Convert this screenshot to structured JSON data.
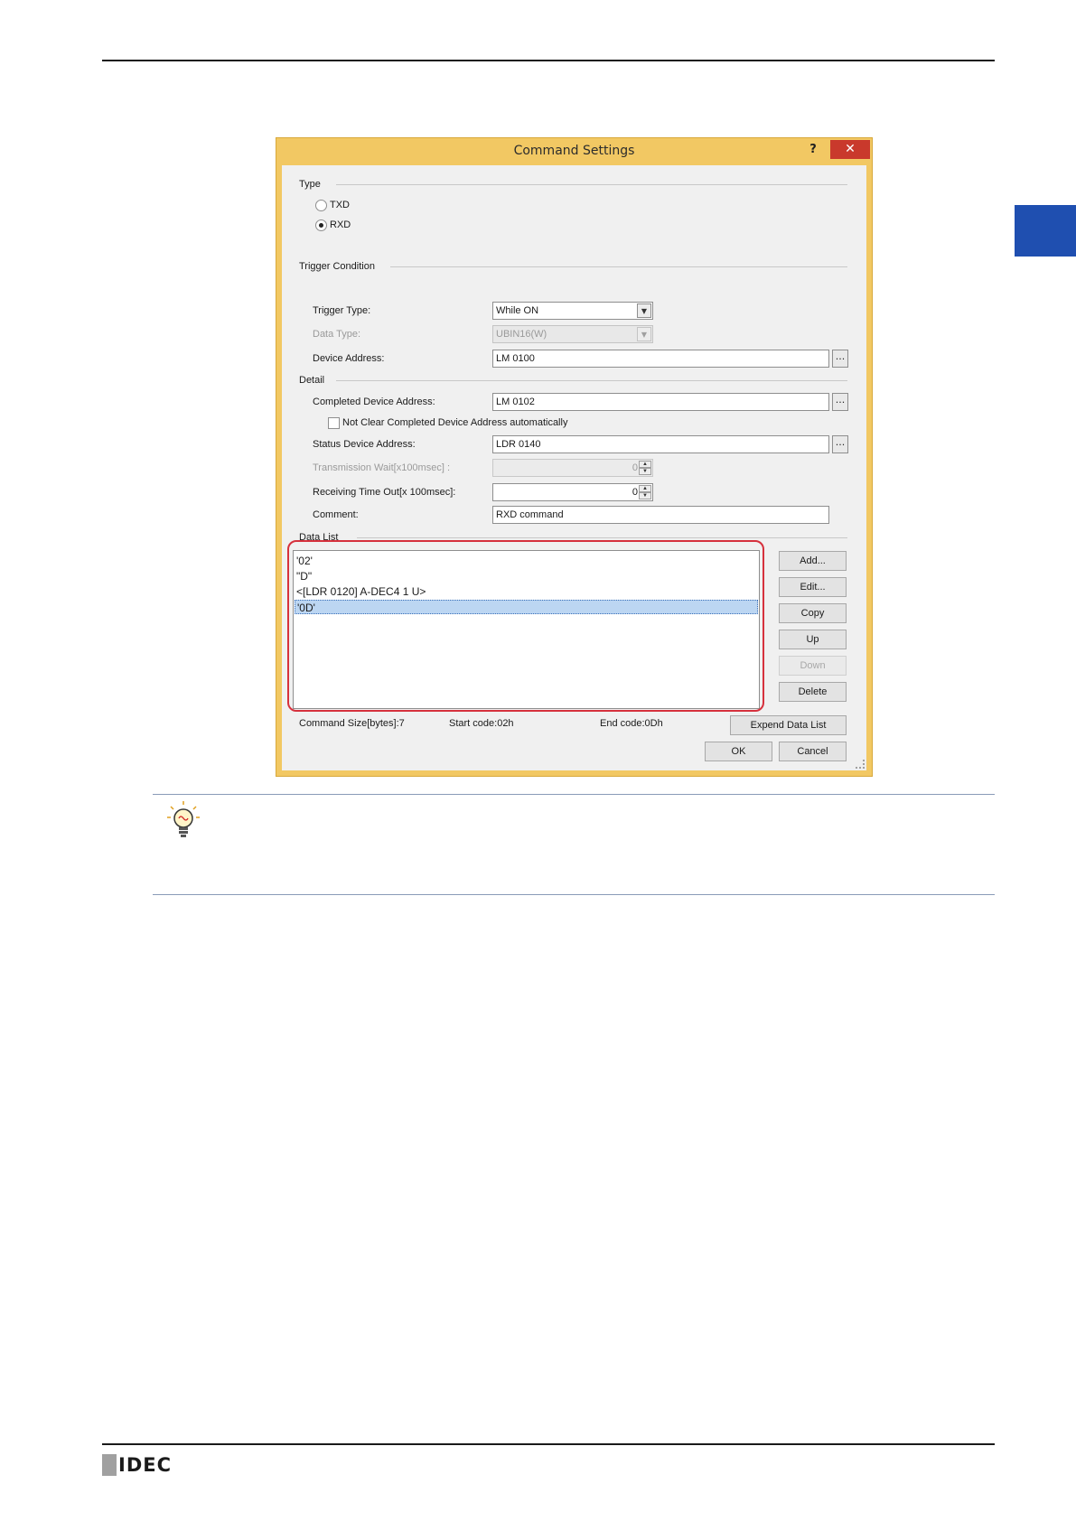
{
  "dialog": {
    "title": "Command Settings",
    "help": "?",
    "close": "✕",
    "type": {
      "label": "Type",
      "options": [
        "TXD",
        "RXD"
      ],
      "selected": "RXD"
    },
    "trigger": {
      "group_label": "Trigger Condition",
      "trigger_type_label": "Trigger Type:",
      "trigger_type_value": "While ON",
      "data_type_label": "Data Type:",
      "data_type_value": "UBIN16(W)",
      "device_address_label": "Device Address:",
      "device_address_value": "LM 0100"
    },
    "detail": {
      "group_label": "Detail",
      "completed_label": "Completed Device Address:",
      "completed_value": "LM 0102",
      "not_clear_label": "Not Clear Completed Device Address automatically",
      "status_label": "Status Device Address:",
      "status_value": "LDR 0140",
      "wait_label": "Transmission Wait[x100msec] :",
      "wait_value": "0",
      "timeout_label": "Receiving Time Out[x 100msec]:",
      "timeout_value": "0",
      "comment_label": "Comment:",
      "comment_value": "RXD command"
    },
    "data_list": {
      "label": "Data List",
      "items": [
        "'02'",
        "\"D\"",
        "<[LDR 0120] A-DEC4 1 U>",
        "'0D'"
      ],
      "selected_index": 3,
      "buttons": {
        "add": "Add...",
        "edit": "Edit...",
        "copy": "Copy",
        "up": "Up",
        "down": "Down",
        "delete": "Delete"
      }
    },
    "footer": {
      "command_size": "Command Size[bytes]:7",
      "start_code": "Start code:02h",
      "end_code": "End code:0Dh",
      "expand": "Expend Data List",
      "ok": "OK",
      "cancel": "Cancel"
    },
    "dots": "..."
  },
  "logo": {
    "text": "IDEC"
  },
  "colors": {
    "dialog_frame": "#f2c863",
    "close_button": "#c9392c",
    "highlight": "#d6313d",
    "side_tab": "#1f4fb0",
    "selection": "#bcd6f2"
  },
  "icons": {
    "tip": "lightbulb-icon"
  }
}
